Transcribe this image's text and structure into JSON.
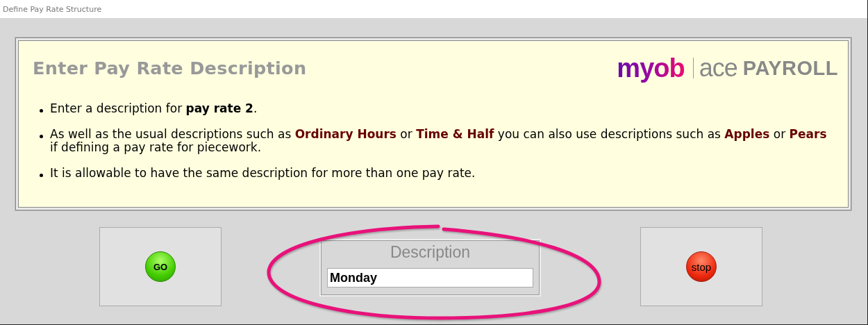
{
  "window": {
    "title": "Define Pay Rate Structure"
  },
  "panel": {
    "heading": "Enter Pay Rate Description",
    "logo": {
      "brand": "myob",
      "product": "ace",
      "suffix": "PAYROLL"
    },
    "bullets": [
      {
        "kind": "plain",
        "text": "Enter a description for **pay rate 2**."
      },
      {
        "kind": "highlight",
        "text": "As well as the usual descriptions such as **Ordinary Hours** or **Time & Half** you can also use descriptions such as **Apples** or **Pears** if defining a pay rate for piecework."
      },
      {
        "kind": "plain",
        "text": "It is allowable to have the same description for more than one pay rate."
      }
    ]
  },
  "go_button": {
    "label": "GO"
  },
  "description": {
    "label": "Description",
    "value": "Monday",
    "highlighted": true
  },
  "stop_button": {
    "label": "stop"
  }
}
